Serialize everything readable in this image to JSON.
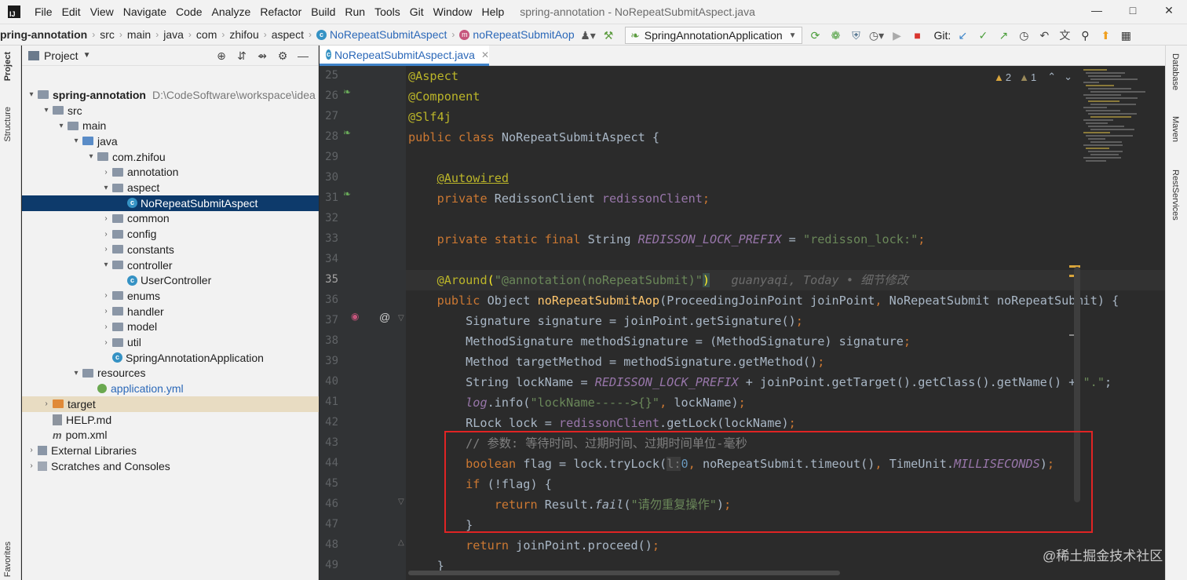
{
  "window": {
    "app_icon": "IJ",
    "title": "spring-annotation - NoRepeatSubmitAspect.java",
    "menu": [
      "File",
      "Edit",
      "View",
      "Navigate",
      "Code",
      "Analyze",
      "Refactor",
      "Build",
      "Run",
      "Tools",
      "Git",
      "Window",
      "Help"
    ],
    "controls": [
      "—",
      "□",
      "✕"
    ]
  },
  "navbar": {
    "breadcrumbs": [
      "pring-annotation",
      "src",
      "main",
      "java",
      "com",
      "zhifou",
      "aspect",
      "NoRepeatSubmitAspect",
      "noRepeatSubmitAop"
    ],
    "run_config": "SpringAnnotationApplication",
    "git_label": "Git:"
  },
  "left_stripe": {
    "tabs": [
      "Project",
      "Structure",
      "Favorites"
    ]
  },
  "project": {
    "title": "Project",
    "tree": [
      {
        "label": "spring-annotation",
        "path": "D:\\CodeSoftware\\workspace\\idea",
        "depth": 0,
        "arrow": "▾",
        "icon": "folder",
        "bold": true
      },
      {
        "label": "src",
        "depth": 1,
        "arrow": "▾",
        "icon": "folder"
      },
      {
        "label": "main",
        "depth": 2,
        "arrow": "▾",
        "icon": "folder"
      },
      {
        "label": "java",
        "depth": 3,
        "arrow": "▾",
        "icon": "folder-blue"
      },
      {
        "label": "com.zhifou",
        "depth": 4,
        "arrow": "▾",
        "icon": "folder"
      },
      {
        "label": "annotation",
        "depth": 5,
        "arrow": "›",
        "icon": "folder"
      },
      {
        "label": "aspect",
        "depth": 5,
        "arrow": "▾",
        "icon": "folder"
      },
      {
        "label": "NoRepeatSubmitAspect",
        "depth": 6,
        "arrow": "",
        "icon": "class",
        "selected": true
      },
      {
        "label": "common",
        "depth": 5,
        "arrow": "›",
        "icon": "folder"
      },
      {
        "label": "config",
        "depth": 5,
        "arrow": "›",
        "icon": "folder"
      },
      {
        "label": "constants",
        "depth": 5,
        "arrow": "›",
        "icon": "folder"
      },
      {
        "label": "controller",
        "depth": 5,
        "arrow": "▾",
        "icon": "folder"
      },
      {
        "label": "UserController",
        "depth": 6,
        "arrow": "",
        "icon": "class"
      },
      {
        "label": "enums",
        "depth": 5,
        "arrow": "›",
        "icon": "folder"
      },
      {
        "label": "handler",
        "depth": 5,
        "arrow": "›",
        "icon": "folder"
      },
      {
        "label": "model",
        "depth": 5,
        "arrow": "›",
        "icon": "folder"
      },
      {
        "label": "util",
        "depth": 5,
        "arrow": "›",
        "icon": "folder"
      },
      {
        "label": "SpringAnnotationApplication",
        "depth": 5,
        "arrow": "",
        "icon": "class"
      },
      {
        "label": "resources",
        "depth": 3,
        "arrow": "▾",
        "icon": "folder"
      },
      {
        "label": "application.yml",
        "depth": 4,
        "arrow": "",
        "icon": "yml",
        "blue": true
      },
      {
        "label": "target",
        "depth": 1,
        "arrow": "›",
        "icon": "folder-orange",
        "highlight": true
      },
      {
        "label": "HELP.md",
        "depth": 1,
        "arrow": "",
        "icon": "md"
      },
      {
        "label": "pom.xml",
        "depth": 1,
        "arrow": "",
        "icon": "m"
      },
      {
        "label": "External Libraries",
        "depth": 0,
        "arrow": "›",
        "icon": "lib"
      },
      {
        "label": "Scratches and Consoles",
        "depth": 0,
        "arrow": "›",
        "icon": "scratch"
      }
    ]
  },
  "editor": {
    "tab_label": "NoRepeatSubmitAspect.java",
    "inspections": {
      "warnings": "2",
      "weak_warnings": "1"
    },
    "line_numbers": [
      "25",
      "26",
      "27",
      "28",
      "29",
      "30",
      "31",
      "32",
      "33",
      "34",
      "35",
      "36",
      "37",
      "38",
      "39",
      "40",
      "41",
      "42",
      "43",
      "44",
      "45",
      "46",
      "47",
      "48",
      "49"
    ],
    "current_line": "35",
    "blame": "guanyaqi, Today • 细节修改",
    "comment_line": "// 参数: 等待时间、过期时间、过期时间单位-毫秒",
    "fail_message": "\"请勿重复操作\""
  },
  "right_stripe": {
    "tabs": [
      "Database",
      "Maven",
      "RestServices"
    ]
  },
  "watermark": "@稀土掘金技术社区"
}
